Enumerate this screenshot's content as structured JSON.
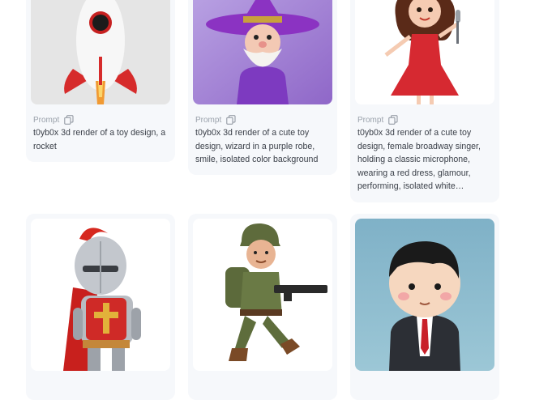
{
  "gallery": {
    "items": [
      {
        "prompt_label": "Prompt",
        "copy_icon": "copy-icon",
        "prompt": "t0yb0x 3d render of a toy design, a rocket",
        "image": "rocket-toy-image"
      },
      {
        "prompt_label": "Prompt",
        "copy_icon": "copy-icon",
        "prompt": "t0yb0x 3d render of a cute toy design, wizard in a purple robe, smile, isolated color background",
        "image": "wizard-toy-image"
      },
      {
        "prompt_label": "Prompt",
        "copy_icon": "copy-icon",
        "prompt": "t0yb0x 3d render of a cute toy design, female broadway singer, holding a classic microphone, wearing a red dress, glamour, performing, isolated white…",
        "image": "singer-toy-image"
      },
      {
        "image": "knight-toy-image"
      },
      {
        "image": "soldier-toy-image"
      },
      {
        "image": "businessman-toy-image"
      }
    ]
  }
}
